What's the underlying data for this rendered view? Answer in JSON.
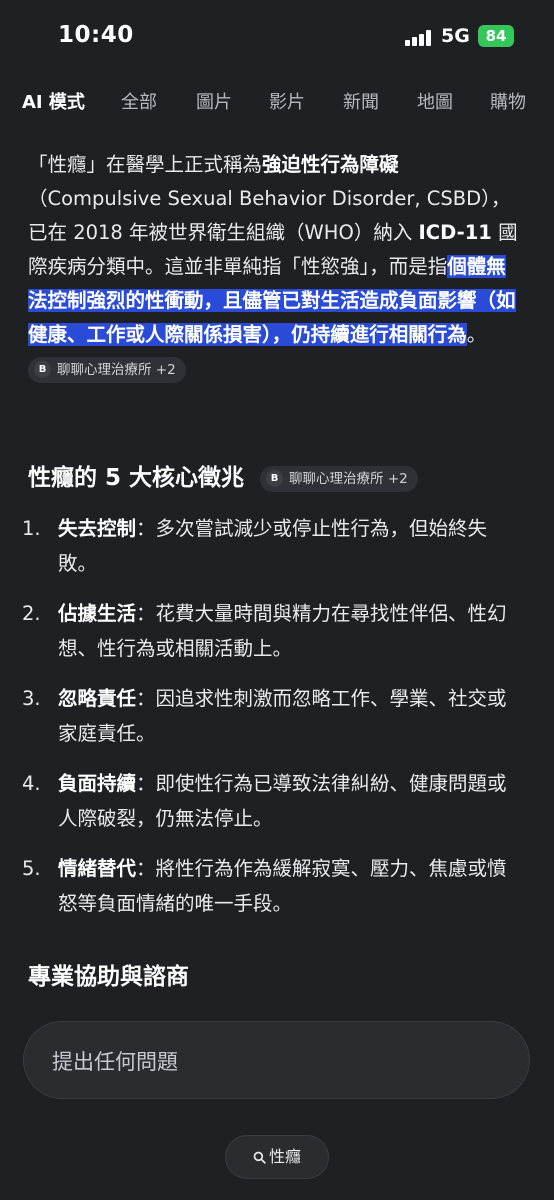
{
  "status": {
    "time": "10:40",
    "network": "5G",
    "battery": "84"
  },
  "tabs": [
    {
      "label": "AI 模式",
      "active": true
    },
    {
      "label": "全部"
    },
    {
      "label": "圖片"
    },
    {
      "label": "影片"
    },
    {
      "label": "新聞"
    },
    {
      "label": "地圖"
    },
    {
      "label": "購物"
    }
  ],
  "intro": {
    "p1": "「性癮」在醫學上正式稱為",
    "term": "強迫性行為障礙",
    "p2": "（Compulsive Sexual Behavior Disorder, CSBD），已在 2018 年被世界衛生組織（WHO）納入 ",
    "icd": "ICD-11",
    "p3": " 國際疾病分類中。這並非單純指「性慾強」，而是指",
    "highlight": "個體無法控制強烈的性衝動，且儘管已對生活造成負面影響（如健康、工作或人際關係損害），仍持續進行相關行為",
    "p4": "。",
    "source": {
      "logo": "B",
      "label": "聊聊心理治療所 +2"
    }
  },
  "signs": {
    "heading": "性癮的 5 大核心徵兆",
    "source": {
      "logo": "B",
      "label": "聊聊心理治療所 +2"
    },
    "items": [
      {
        "num": "1.",
        "title": "失去控制",
        "text": "：多次嘗試減少或停止性行為，但始終失敗。"
      },
      {
        "num": "2.",
        "title": "佔據生活",
        "text": "：花費大量時間與精力在尋找性伴侶、性幻想、性行為或相關活動上。"
      },
      {
        "num": "3.",
        "title": "忽略責任",
        "text": "：因追求性刺激而忽略工作、學業、社交或家庭責任。"
      },
      {
        "num": "4.",
        "title": "負面持續",
        "text": "：即使性行為已導致法律糾紛、健康問題或人際破裂，仍無法停止。"
      },
      {
        "num": "5.",
        "title": "情緒替代",
        "text": "：將性行為作為緩解寂寞、壓力、焦慮或憤怒等負面情緒的唯一手段。"
      }
    ]
  },
  "help_heading": "專業協助與諮商",
  "ask_placeholder": "提出任何問題",
  "query_pill": "性癮",
  "colors": {
    "background": "#1f2024",
    "highlight": "#2a4bd7",
    "battery": "#34c759"
  }
}
